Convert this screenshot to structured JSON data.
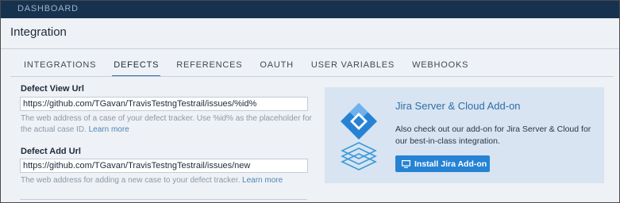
{
  "header": {
    "breadcrumb": "DASHBOARD"
  },
  "page": {
    "title": "Integration"
  },
  "tabs": [
    {
      "label": "INTEGRATIONS",
      "active": false
    },
    {
      "label": "DEFECTS",
      "active": true
    },
    {
      "label": "REFERENCES",
      "active": false
    },
    {
      "label": "OAUTH",
      "active": false
    },
    {
      "label": "USER VARIABLES",
      "active": false
    },
    {
      "label": "WEBHOOKS",
      "active": false
    }
  ],
  "defect_view": {
    "label": "Defect View Url",
    "value": "https://github.com/TGavan/TravisTestngTestrail/issues/%id%",
    "help": "The web address of a case of your defect tracker. Use %id% as the placeholder for the actual case ID.",
    "help_link": "Learn more"
  },
  "defect_add": {
    "label": "Defect Add Url",
    "value": "https://github.com/TGavan/TravisTestngTestrail/issues/new",
    "help": "The web address for adding a new case to your defect tracker.",
    "help_link": "Learn more"
  },
  "jira_card": {
    "title": "Jira Server & Cloud Add-on",
    "text": "Also check out our add-on for Jira Server & Cloud for our best-in-class integration.",
    "button_label": "Install Jira Add-on",
    "icon": "jira-stack-logo",
    "colors": {
      "background": "#d8e4f1",
      "accent": "#2683d4",
      "title": "#2f6ea8"
    }
  },
  "colors": {
    "topbar": "#16324f",
    "page_bg": "#eef1f5",
    "tab_underline": "#2f6ea8"
  }
}
